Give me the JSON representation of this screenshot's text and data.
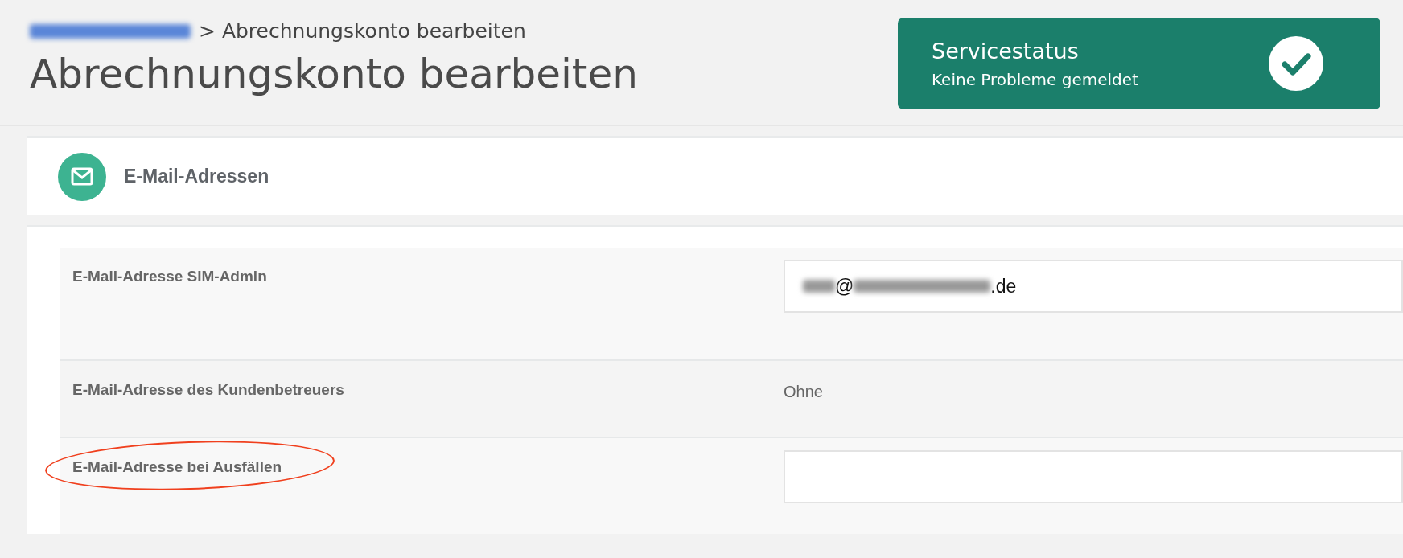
{
  "breadcrumb": [
    {
      "kind": "blur"
    },
    {
      "kind": "text",
      "text": "> Abrechnungskonto bearbeiten"
    }
  ],
  "title": "Abrechnungskonto bearbeiten",
  "service_status": {
    "title": "Servicestatus",
    "message": "Keine Probleme gemeldet",
    "ok": true
  },
  "section": {
    "title": "E-Mail-Adressen",
    "rows": [
      {
        "label": "E-Mail-Adresse SIM-Admin",
        "kind": "input",
        "highlighted": false,
        "value": [
          {
            "kind": "blur"
          },
          {
            "kind": "text",
            "text": "@"
          },
          {
            "kind": "blur"
          },
          {
            "kind": "text",
            "text": ".de"
          }
        ]
      },
      {
        "label": "E-Mail-Adresse des Kundenbetreuers",
        "kind": "text",
        "highlighted": false,
        "text": "Ohne"
      },
      {
        "label": "E-Mail-Adresse bei Ausfällen",
        "kind": "input",
        "highlighted": true,
        "value": []
      }
    ]
  }
}
